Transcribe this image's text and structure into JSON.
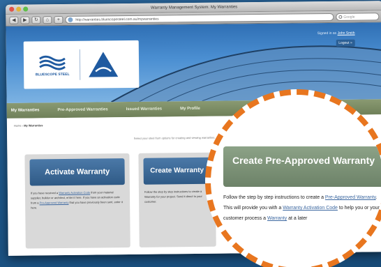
{
  "window": {
    "title": "Warranty Management System: My Warranties",
    "url": "http://warranties.bluescopesteel.com.au/mywarranties",
    "search_placeholder": "Google",
    "nav_back": "◀",
    "nav_forward": "▶"
  },
  "header": {
    "signed_in_prefix": "Signed in as",
    "signed_in_user": "John Smith",
    "logout_label": "Logout »",
    "logo_bluescope": "BLUESCOPE STEEL",
    "colors": {
      "hero_blue": "#2f6fb4",
      "nav_green": "#7a8b63",
      "zoom_ring": "#e8761f"
    }
  },
  "nav": {
    "items": [
      {
        "label": "My Warranties"
      },
      {
        "label": "Pre-Approved Warranties"
      },
      {
        "label": "Issued Warranties"
      },
      {
        "label": "My Profile"
      }
    ]
  },
  "breadcrumb": {
    "home": "Home",
    "sep": "›",
    "current": "My Warranties"
  },
  "intro_text": "Select your steel from options for creating and viewing warranties.",
  "cards": {
    "activate": {
      "title": "Activate Warranty",
      "body_a": "If you have received a ",
      "body_link1": "Warranty Activation Code",
      "body_b": " from your material supplier, builder or architect, enter it here. If you have an activation code from a ",
      "body_link2": "Pre-Approved Warranty",
      "body_c": " that you have previously been sent, enter it here."
    },
    "create_partial": {
      "title": "Create Warranty",
      "body": "Follow the step by step instructions to create a Warranty for your project. Send it direct to your customer."
    }
  },
  "zoom": {
    "title": "Create Pre-Approved Warranty",
    "body_a": "Follow the step by step instructions to create a ",
    "link1": "Pre-Approved Warranty",
    "body_b": ". This will provide you with a ",
    "link2": "Warranty Activation Code",
    "body_c": " to help you or your customer process a ",
    "link3": "Warranty",
    "body_d": " at a later"
  }
}
